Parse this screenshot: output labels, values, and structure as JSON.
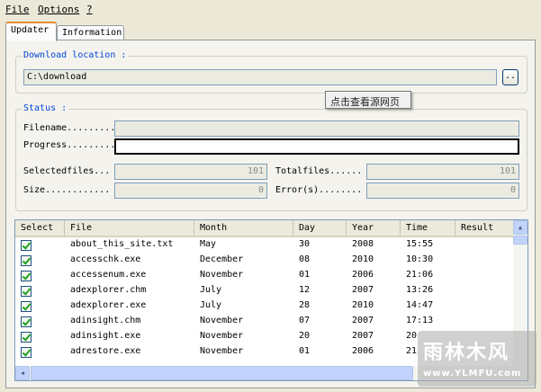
{
  "menu": {
    "items": [
      {
        "label": "File"
      },
      {
        "label": "Options"
      },
      {
        "label": "?"
      }
    ]
  },
  "tabs": [
    {
      "label": "Updater"
    },
    {
      "label": "Information"
    }
  ],
  "download": {
    "title": "Download location :",
    "path": "C:\\download",
    "browse_label": ".."
  },
  "tooltip": "点击查看源网页",
  "status": {
    "title": "Status :",
    "filename_label": "Filename.........",
    "filename_value": "",
    "progress_label": "Progress.........",
    "progress_fraction": 0,
    "selectedfiles_label": "Selectedfiles...",
    "selectedfiles_value": "101",
    "size_label": "Size............",
    "size_value": "0",
    "totalfiles_label": "Totalfiles......",
    "totalfiles_value": "101",
    "errors_label": "Error(s)........",
    "errors_value": "0"
  },
  "list": {
    "columns": [
      "Select",
      "File",
      "Month",
      "Day",
      "Year",
      "Time",
      "Result"
    ],
    "rows": [
      {
        "file": "about_this_site.txt",
        "month": "May",
        "day": "30",
        "year": "2008",
        "time": "15:55",
        "result": ""
      },
      {
        "file": "accesschk.exe",
        "month": "December",
        "day": "08",
        "year": "2010",
        "time": "10:30",
        "result": ""
      },
      {
        "file": "accessenum.exe",
        "month": "November",
        "day": "01",
        "year": "2006",
        "time": "21:06",
        "result": ""
      },
      {
        "file": "adexplorer.chm",
        "month": "July",
        "day": "12",
        "year": "2007",
        "time": "13:26",
        "result": ""
      },
      {
        "file": "adexplorer.exe",
        "month": "July",
        "day": "28",
        "year": "2010",
        "time": "14:47",
        "result": ""
      },
      {
        "file": "adinsight.chm",
        "month": "November",
        "day": "07",
        "year": "2007",
        "time": "17:13",
        "result": ""
      },
      {
        "file": "adinsight.exe",
        "month": "November",
        "day": "20",
        "year": "2007",
        "time": "20",
        "result": ""
      },
      {
        "file": "adrestore.exe",
        "month": "November",
        "day": "01",
        "year": "2006",
        "time": "21",
        "result": ""
      }
    ]
  },
  "watermark": {
    "text": "雨林木风",
    "url": "www.YLMFU.com"
  }
}
